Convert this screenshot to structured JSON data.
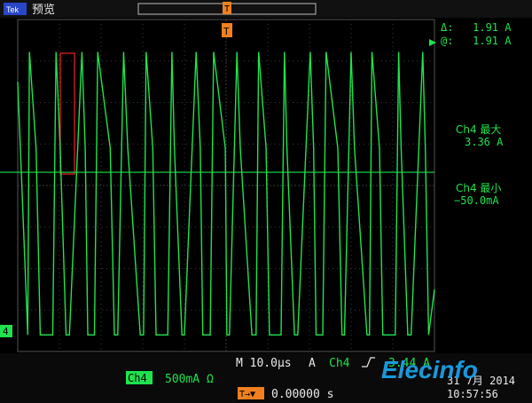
{
  "top_bar": {
    "mode_icon_text": "Tek",
    "mode_label": "预览",
    "trigger_marker": "T"
  },
  "cursor_readout": {
    "delta": "Δ:   1.91 A",
    "at": "@:   1.91 A"
  },
  "measurements": [
    {
      "label": "Ch4 最大",
      "value": "3.36 A"
    },
    {
      "label": "Ch4 最小",
      "value": "−50.0mA"
    }
  ],
  "channel_marker": "4",
  "bottom_bar": {
    "timebase": "M 10.0µs",
    "acq_mode": "A",
    "trigger_channel": "Ch4",
    "trigger_slope_icon": "rising-edge-icon",
    "trigger_level": "3.44 A",
    "channel_badge": "Ch4",
    "channel_scale": "500mA Ω",
    "trigger_position_label": "T→▼",
    "trigger_position_value": "0.00000 s",
    "date": "31 7月 2014",
    "time": "10:57:56"
  },
  "watermark": "Elecinfo",
  "colors": {
    "trace": "#1ee34e",
    "grid": "#3b3b3b",
    "trigger": "#f08020",
    "bars": "#3a3a3a",
    "cursor_box": "#e02020"
  },
  "chart_data": {
    "type": "line",
    "series": [
      {
        "name": "Ch4",
        "x_us": [
          -50,
          -47.6,
          -47.2,
          -45.6,
          -44.6,
          -41.6,
          -40.8,
          -39.8,
          -38.4,
          -37.6,
          -34.6,
          -33.8,
          -33.2,
          -31.6,
          -30.8,
          -27.8,
          -26.8,
          -26,
          -24.6,
          -23.6,
          -20.6,
          -19.8,
          -19.2,
          -17.6,
          -16.8,
          -14,
          -13,
          -12.4,
          -10.6,
          -10,
          -7.2,
          -6.2,
          -5.6,
          -3.8,
          -3,
          -0.2,
          0.2,
          0.8,
          2.6,
          3.4,
          6.2,
          7.2,
          7.8,
          9.6,
          10.4,
          13.2,
          14,
          14.6,
          16.4,
          17.2,
          20.2,
          21,
          21.6,
          23.2,
          24,
          26.8,
          27.8,
          28.4,
          30,
          30.8,
          33.8,
          34.4,
          35,
          36.8,
          37.6,
          40.6,
          41.4,
          42,
          43.6,
          44.4,
          47.2,
          47.8,
          48.6,
          50
        ],
        "amps": [
          3.0,
          -0.05,
          3.36,
          2.2,
          -0.05,
          -0.05,
          3.36,
          2.2,
          -0.05,
          -0.05,
          3.36,
          2.2,
          -0.05,
          -0.05,
          3.36,
          2.2,
          -0.05,
          -0.05,
          3.36,
          2.2,
          -0.05,
          -0.05,
          3.36,
          2.2,
          -0.05,
          -0.05,
          3.36,
          2.2,
          -0.05,
          -0.05,
          3.36,
          2.2,
          -0.05,
          -0.05,
          3.36,
          2.2,
          -0.05,
          -0.05,
          3.36,
          2.2,
          -0.05,
          -0.05,
          3.36,
          2.2,
          -0.05,
          -0.05,
          3.36,
          2.2,
          -0.05,
          -0.05,
          3.36,
          2.2,
          -0.05,
          -0.05,
          3.36,
          2.2,
          -0.05,
          -0.05,
          3.36,
          2.2,
          -0.05,
          -0.05,
          3.36,
          2.2,
          -0.05,
          -0.05,
          3.36,
          2.2,
          -0.05,
          -0.05,
          3.36,
          2.2,
          -0.05,
          0.5
        ]
      }
    ],
    "xlim_us": [
      -50,
      50
    ],
    "ylim_amps": [
      -0.25,
      3.75
    ],
    "x_divisions": 10,
    "y_divisions": 8,
    "cursor_level_amps": 1.91,
    "grid": true
  }
}
